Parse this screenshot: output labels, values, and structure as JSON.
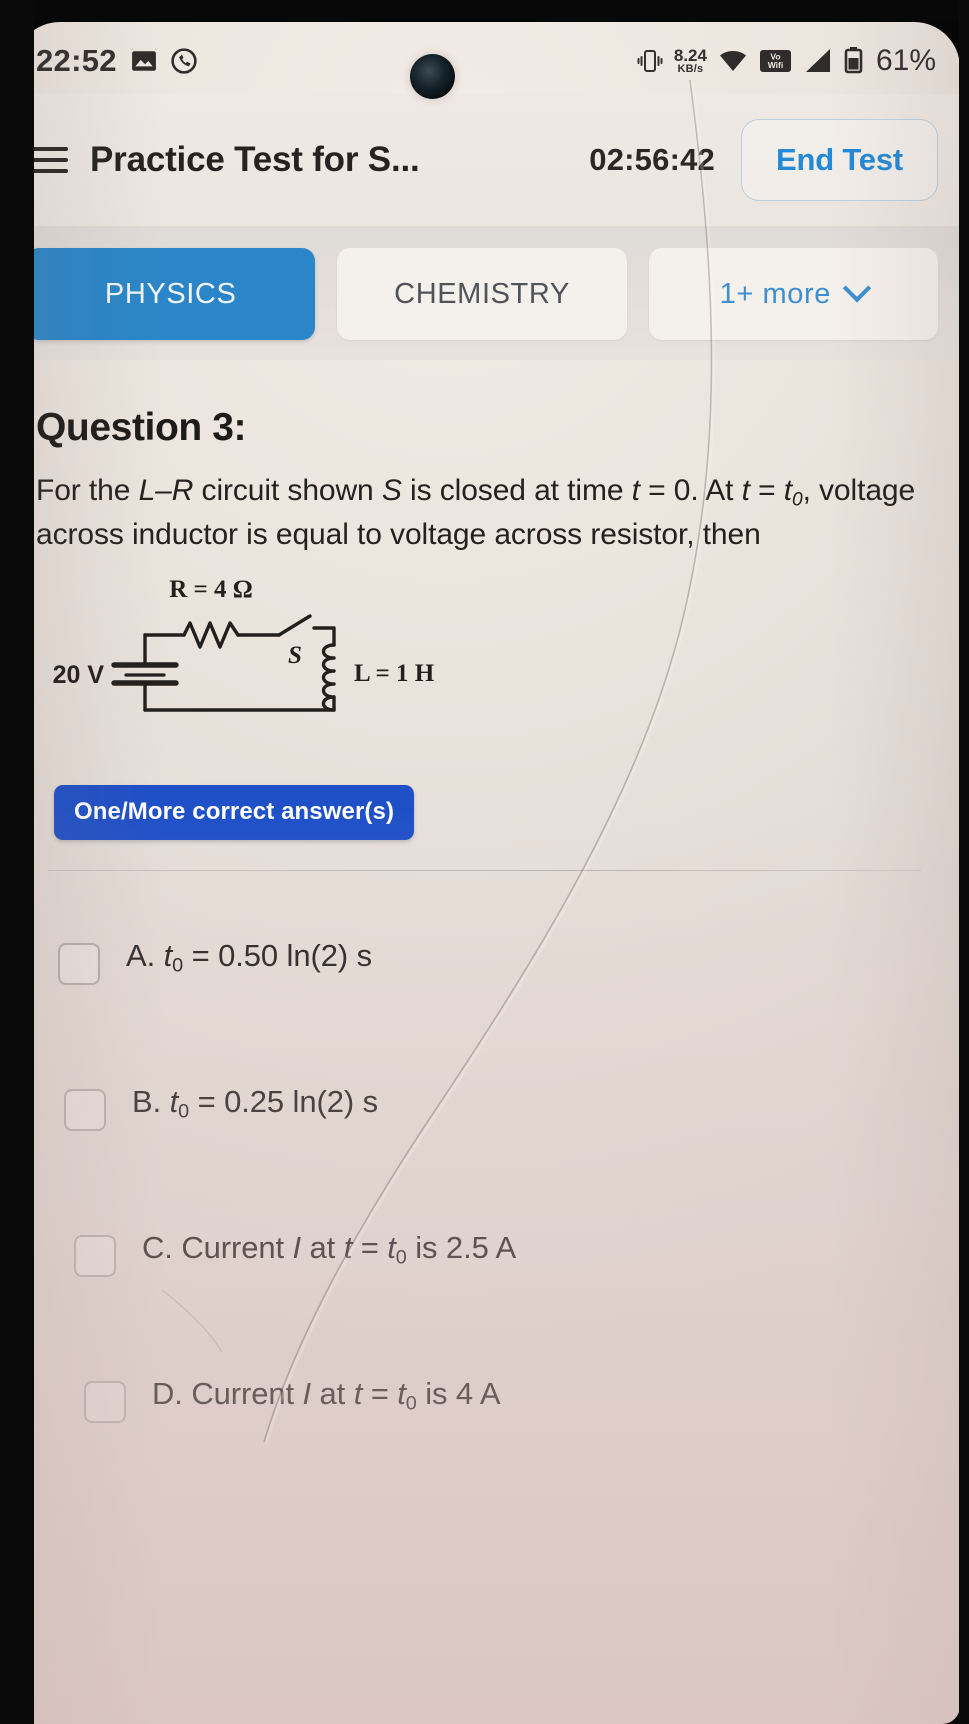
{
  "status_bar": {
    "time": "22:52",
    "network_speed_value": "8.24",
    "network_speed_unit": "KB/s",
    "vowifi_label": "Vo\nWifi",
    "battery_percent": "61%",
    "icons": [
      "gallery-icon",
      "call-history-icon",
      "camera-punchhole",
      "vibrate-icon",
      "wifi-icon",
      "vowifi-icon",
      "signal-icon",
      "battery-icon"
    ]
  },
  "header": {
    "menu_icon": "hamburger-menu-icon",
    "title": "Practice Test for S...",
    "timer": "02:56:42",
    "end_test_label": "End Test"
  },
  "tabs": [
    {
      "label": "PHYSICS",
      "active": true
    },
    {
      "label": "CHEMISTRY",
      "active": false
    },
    {
      "label": "1+ more",
      "active": false,
      "has_chevron": true
    }
  ],
  "question": {
    "title": "Question 3:",
    "line1_a": "For the ",
    "line1_LR": "L–R",
    "line1_b": " circuit shown ",
    "line1_S": "S",
    "line1_c": " is closed at time ",
    "line1_t": "t",
    "line1_d": " = 0. At ",
    "line1_t2": "t",
    "line1_e": " = ",
    "line1_t0": "t",
    "line1_t0sub": "0",
    "line1_f": ", voltage across inductor is equal to voltage across resistor, then",
    "answer_type_badge": "One/More correct answer(s)"
  },
  "circuit": {
    "source_label": "20 V",
    "resistor_label": "R = 4 Ω",
    "switch_label": "S",
    "inductor_label": "L = 1 H"
  },
  "options": [
    {
      "letter": "A.",
      "text": "t₀ = 0.50 ln(2) s",
      "checked": false
    },
    {
      "letter": "B.",
      "text": "t₀ = 0.25 ln(2) s",
      "checked": false
    },
    {
      "letter": "C.",
      "text": "Current I at t = t₀ is 2.5 A",
      "checked": false
    },
    {
      "letter": "D.",
      "text": "Current I at t = t₀ is 4 A",
      "checked": false
    }
  ],
  "colors": {
    "accent_blue": "#2a86c8",
    "badge_blue": "#1f50c8",
    "link_blue": "#2489d6",
    "screen_bg": "#ece5de"
  }
}
